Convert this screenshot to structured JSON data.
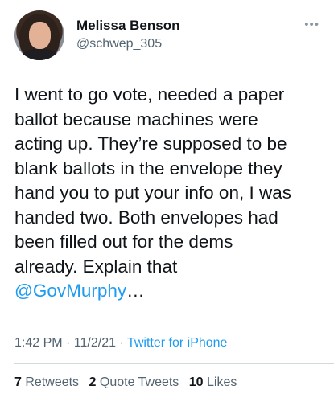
{
  "author": {
    "display_name": "Melissa Benson",
    "handle": "@schwep_305"
  },
  "more_icon": "ellipsis-icon",
  "tweet": {
    "lines": [
      "I went to go vote, needed a paper",
      "ballot because machines were",
      "acting up. They’re supposed to be",
      "blank ballots in the envelope they",
      "hand you to put your info on, I was",
      "handed two. Both envelopes had",
      "been filled out for the dems",
      "already. Explain that"
    ],
    "mention": "@GovMurphy",
    "ellipsis": "…"
  },
  "meta": {
    "time": "1:42 PM",
    "separator": " · ",
    "date": "11/2/21",
    "source": "Twitter for iPhone"
  },
  "stats": {
    "retweets_count": "7",
    "retweets_label": "Retweets",
    "quote_count": "2",
    "quote_label": "Quote Tweets",
    "likes_count": "10",
    "likes_label": "Likes"
  },
  "colors": {
    "link": "#1d9bf0",
    "secondary_text": "#536471",
    "primary_text": "#0f1419"
  }
}
